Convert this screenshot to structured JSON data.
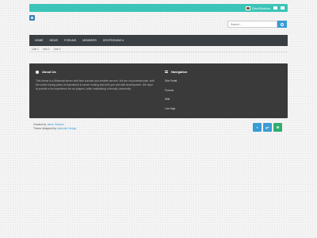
{
  "topbar": {
    "username": "DinoShieldor",
    "icons": [
      "envelope-icon",
      "comment-icon"
    ]
  },
  "search": {
    "placeholder": "Search..."
  },
  "nav": {
    "items": [
      "HOME",
      "NEWS",
      "FORUMS",
      "MEMBERS",
      "DROPDOWNS ▾"
    ]
  },
  "subnav": {
    "items": [
      "Link 1",
      "Link 2",
      "Link 3"
    ]
  },
  "about": {
    "title": "About Us",
    "text": "This theme is a Minecraft server with both survival and creative servers. We are not professionals, with the owner having years of experience in server hosting and both you and web development. We hope to provide a fun experience for our players, while maintaining a friendly community."
  },
  "navigation": {
    "title": "Navigation",
    "links": [
      "Site Portal",
      "Forums",
      "Wiki",
      "Live Map"
    ]
  },
  "credits": {
    "created_prefix": "Created by",
    "created_link": "Jamie Stephen",
    "theme_prefix": "Theme designed by",
    "theme_link": "Avalonite Design"
  },
  "social": {
    "twitter": "t",
    "googleplus": "g+",
    "email": "✉"
  },
  "colors": {
    "accent": "#3cc4b8",
    "nav": "#3a3f44",
    "footer": "#3a3a3a",
    "link": "#3a9bd5"
  }
}
